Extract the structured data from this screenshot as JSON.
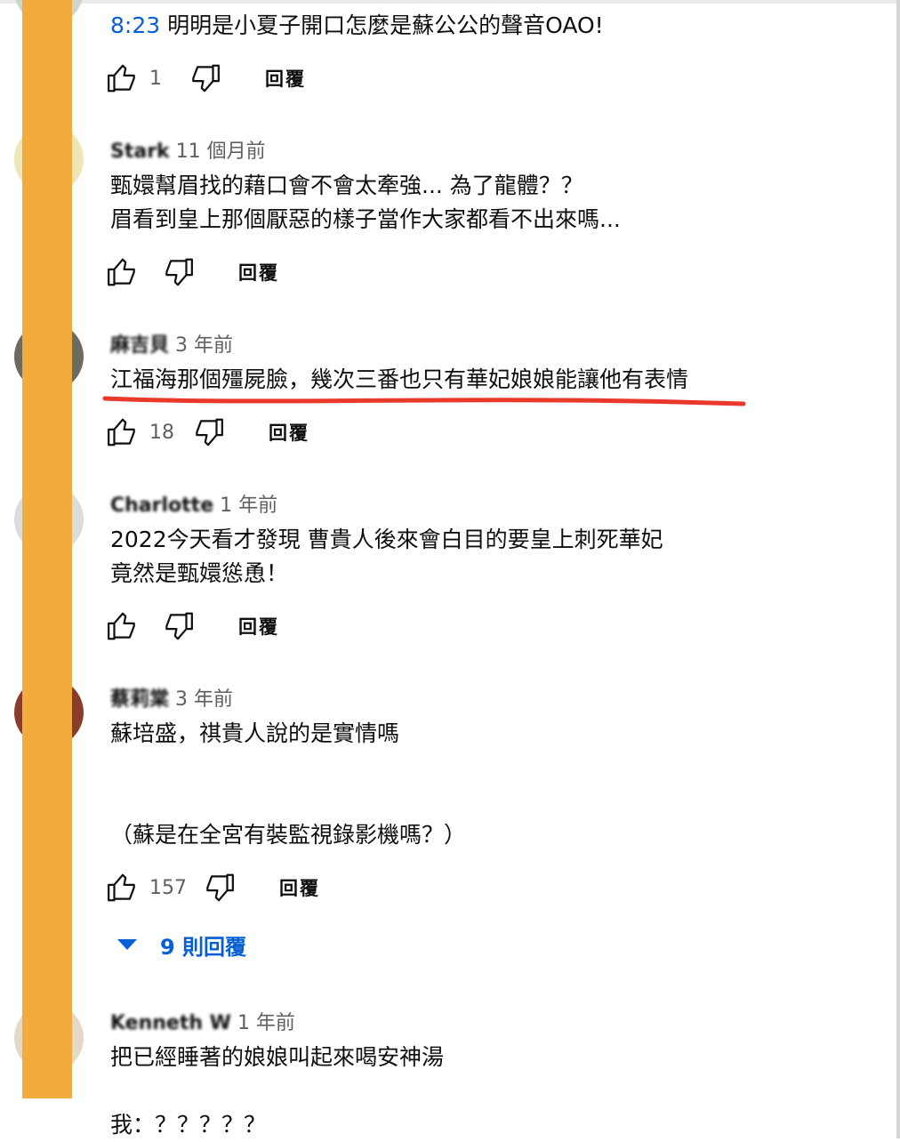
{
  "comments": [
    {
      "timestamp_link": "8:23",
      "text": " 明明是小夏子開口怎麼是蘇公公的聲音OAO!",
      "likes": "1",
      "reply_label": "回覆"
    },
    {
      "author": "Stark",
      "time": "11 個月前",
      "lines": [
        "甄嬛幫眉找的藉口會不會太牽強... 為了龍體？？",
        "眉看到皇上那個厭惡的樣子當作大家都看不出來嗎..."
      ],
      "likes": "",
      "reply_label": "回覆"
    },
    {
      "author": "麻吉貝",
      "time": "3 年前",
      "lines": [
        "江福海那個殭屍臉，幾次三番也只有華妃娘娘能讓他有表情"
      ],
      "likes": "18",
      "reply_label": "回覆"
    },
    {
      "author": "Charlotte",
      "time": "1 年前",
      "lines": [
        "2022今天看才發現 曹貴人後來會白目的要皇上刺死華妃",
        "竟然是甄嬛慫恿！"
      ],
      "likes": "",
      "reply_label": "回覆"
    },
    {
      "author": "蔡莉棠",
      "time": "3 年前",
      "lines": [
        "蘇培盛，祺貴人說的是實情嗎",
        "",
        "",
        "（蘇是在全宮有裝監視錄影機嗎？）"
      ],
      "likes": "157",
      "reply_label": "回覆",
      "replies_toggle": "9 則回覆"
    },
    {
      "author": "Kenneth W",
      "time": "1 年前",
      "lines": [
        "把已經睡著的娘娘叫起來喝安神湯",
        "",
        "我：？？？？？"
      ]
    }
  ],
  "colors": {
    "mask": "#f2ac3d",
    "underline": "#e8392b",
    "link": "#065fd4"
  },
  "icons": [
    "thumb-up-icon",
    "thumb-down-icon",
    "caret-down-icon"
  ]
}
